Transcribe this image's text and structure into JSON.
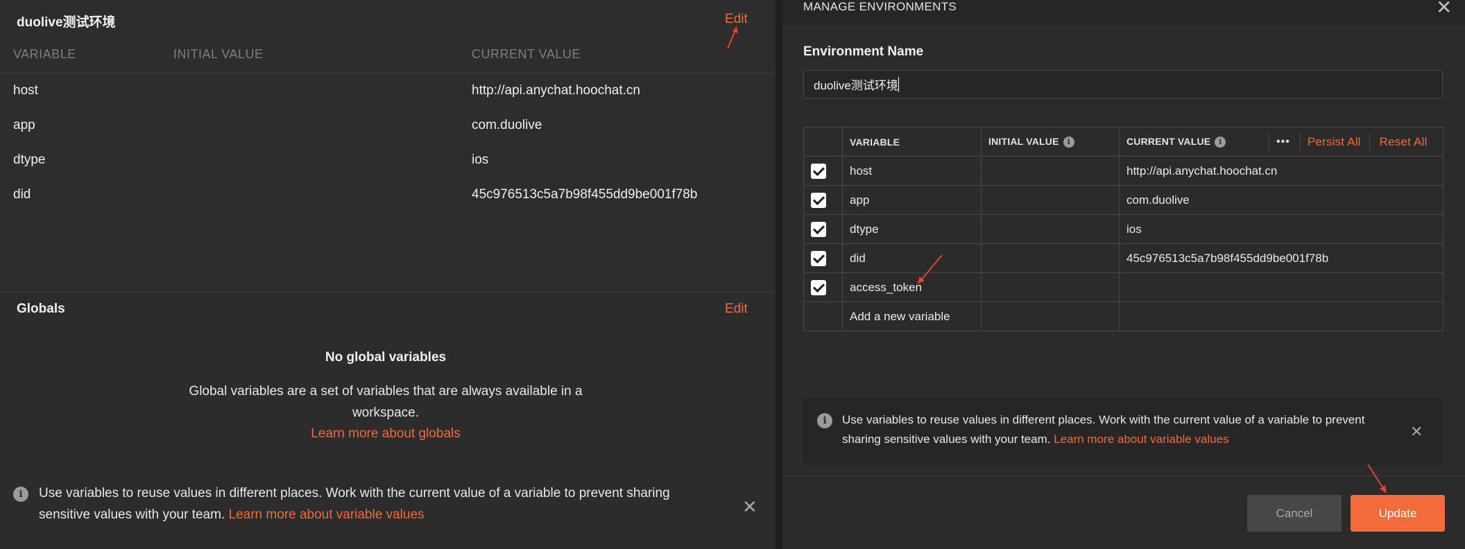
{
  "left": {
    "environment": {
      "title": "duolive测试环境",
      "edit_label": "Edit",
      "columns": [
        "VARIABLE",
        "INITIAL VALUE",
        "CURRENT VALUE"
      ],
      "rows": [
        {
          "variable": "host",
          "initial": "",
          "current": "http://api.anychat.hoochat.cn"
        },
        {
          "variable": "app",
          "initial": "",
          "current": "com.duolive"
        },
        {
          "variable": "dtype",
          "initial": "",
          "current": "ios"
        },
        {
          "variable": "did",
          "initial": "",
          "current": "45c976513c5a7b98f455dd9be001f78b"
        }
      ]
    },
    "globals": {
      "title": "Globals",
      "edit_label": "Edit",
      "empty_title": "No global variables",
      "empty_desc": "Global variables are a set of variables that are always available in a workspace.",
      "learn_more": "Learn more about globals"
    },
    "banner": {
      "text": "Use variables to reuse values in different places. Work with the current value of a variable to prevent sharing sensitive values with your team.",
      "link": "Learn more about variable values"
    }
  },
  "modal": {
    "title": "MANAGE ENVIRONMENTS",
    "env_name_label": "Environment Name",
    "env_name_value": "duolive测试环境",
    "columns": {
      "variable": "VARIABLE",
      "initial": "INITIAL VALUE",
      "current": "CURRENT VALUE",
      "more": "•••",
      "persist_all": "Persist All",
      "reset_all": "Reset All"
    },
    "rows": [
      {
        "variable": "host",
        "initial": "",
        "current": "http://api.anychat.hoochat.cn"
      },
      {
        "variable": "app",
        "initial": "",
        "current": "com.duolive"
      },
      {
        "variable": "dtype",
        "initial": "",
        "current": "ios"
      },
      {
        "variable": "did",
        "initial": "",
        "current": "45c976513c5a7b98f455dd9be001f78b"
      },
      {
        "variable": "access_token",
        "initial": "",
        "current": ""
      }
    ],
    "new_variable_placeholder": "Add a new variable",
    "banner": {
      "text": "Use variables to reuse values in different places. Work with the current value of a variable to prevent sharing sensitive values with your team.",
      "link": "Learn more about variable values"
    },
    "cancel_label": "Cancel",
    "update_label": "Update"
  },
  "colors": {
    "accent": "#f26b3a",
    "background": "#2c2c2c",
    "arrow": "#e8432a"
  },
  "icons": [
    "info-icon",
    "close-icon",
    "checkbox-checked-icon",
    "more-icon"
  ]
}
